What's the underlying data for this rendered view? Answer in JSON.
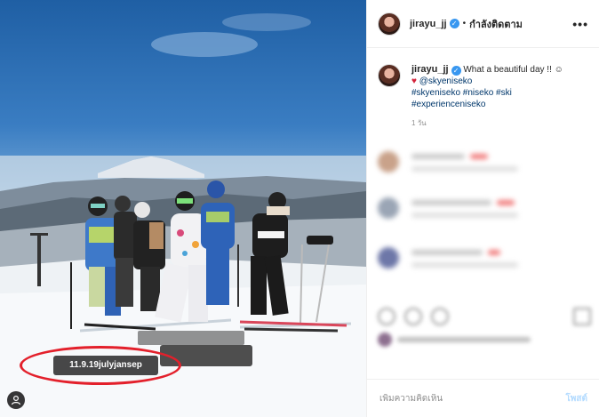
{
  "post": {
    "username": "jirayu_jj",
    "follow_status": "กำลังติดตาม",
    "more_label": "•••",
    "tag_label": "11.9.19julyjansep"
  },
  "caption": {
    "username": "jirayu_jj",
    "text": "What a beautiful day !! ☺",
    "heart": "♥",
    "mention": "@skyeniseko",
    "hashtags_line1": "#skyeniseko #niseko #ski",
    "hashtags_line2": "#experienceniseko",
    "time_ago": "1 วัน"
  },
  "comment_bar": {
    "placeholder": "เพิ่มความคิดเห็น",
    "post_label": "โพสต์"
  },
  "icons": {
    "verified": "verified-badge-icon",
    "more": "more-options-icon",
    "user_tag": "user-tag-icon",
    "heart": "heart-icon"
  },
  "colors": {
    "verified_blue": "#3897f0",
    "link_blue": "#00376b",
    "highlight_red": "#e3202b",
    "post_disabled": "#b3dbff"
  }
}
